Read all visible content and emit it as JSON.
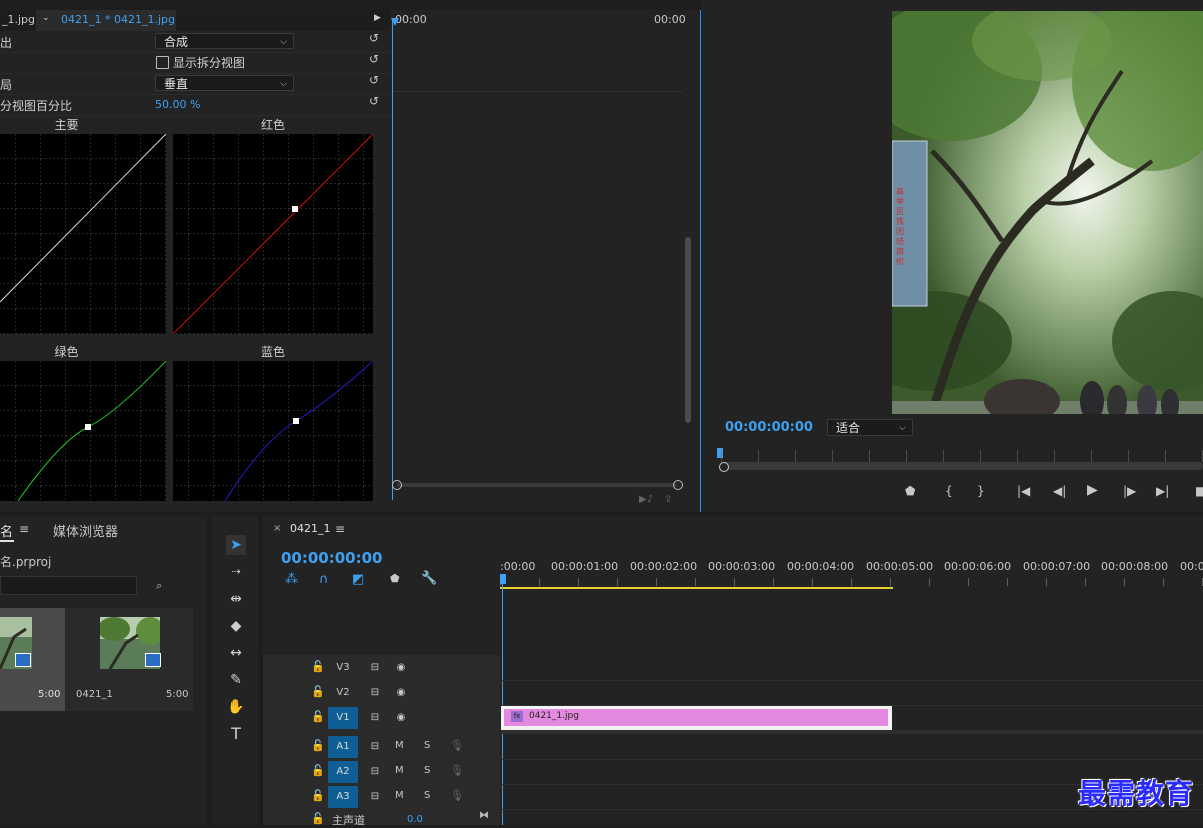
{
  "effect_controls": {
    "tab_left": "_1.jpg",
    "tab_active": "0421_1 * 0421_1.jpg",
    "time_start": "00:00",
    "time_end": "00:00",
    "rows": [
      {
        "label": "出",
        "value": "合成",
        "type": "dropdown"
      },
      {
        "label": "",
        "value": "显示拆分视图",
        "type": "checkbox"
      },
      {
        "label": "局",
        "value": "垂直",
        "type": "dropdown"
      },
      {
        "label": "分视图百分比",
        "value": "50.00 %",
        "type": "number"
      }
    ],
    "curves": [
      {
        "title": "主要",
        "color": "#e0e0e0"
      },
      {
        "title": "红色",
        "color": "#d01010"
      },
      {
        "title": "绿色",
        "color": "#20c020"
      },
      {
        "title": "蓝色",
        "color": "#2020d0"
      }
    ]
  },
  "program_monitor": {
    "timecode": "00:00:00:00",
    "zoom": "适合",
    "banner_text": "高举民族团结旗帜"
  },
  "project": {
    "tab_name": "名",
    "tab_media": "媒体浏览器",
    "file": "名.prproj",
    "items": [
      {
        "name": "",
        "duration": "5:00"
      },
      {
        "name": "0421_1",
        "duration": "5:00"
      }
    ]
  },
  "timeline": {
    "sequence_name": "0421_1",
    "timecode": "00:00:00:00",
    "ruler": [
      ":00:00",
      "00:00:01:00",
      "00:00:02:00",
      "00:00:03:00",
      "00:00:04:00",
      "00:00:05:00",
      "00:00:06:00",
      "00:00:07:00",
      "00:00:08:00",
      "00:0"
    ],
    "video_tracks": [
      "V3",
      "V2",
      "V1"
    ],
    "audio_tracks": [
      "A1",
      "A2",
      "A3"
    ],
    "clip_name": "0421_1.jpg",
    "master_label": "主声道",
    "master_value": "0.0",
    "mute": "M",
    "solo": "S"
  },
  "watermark": "最需教育"
}
